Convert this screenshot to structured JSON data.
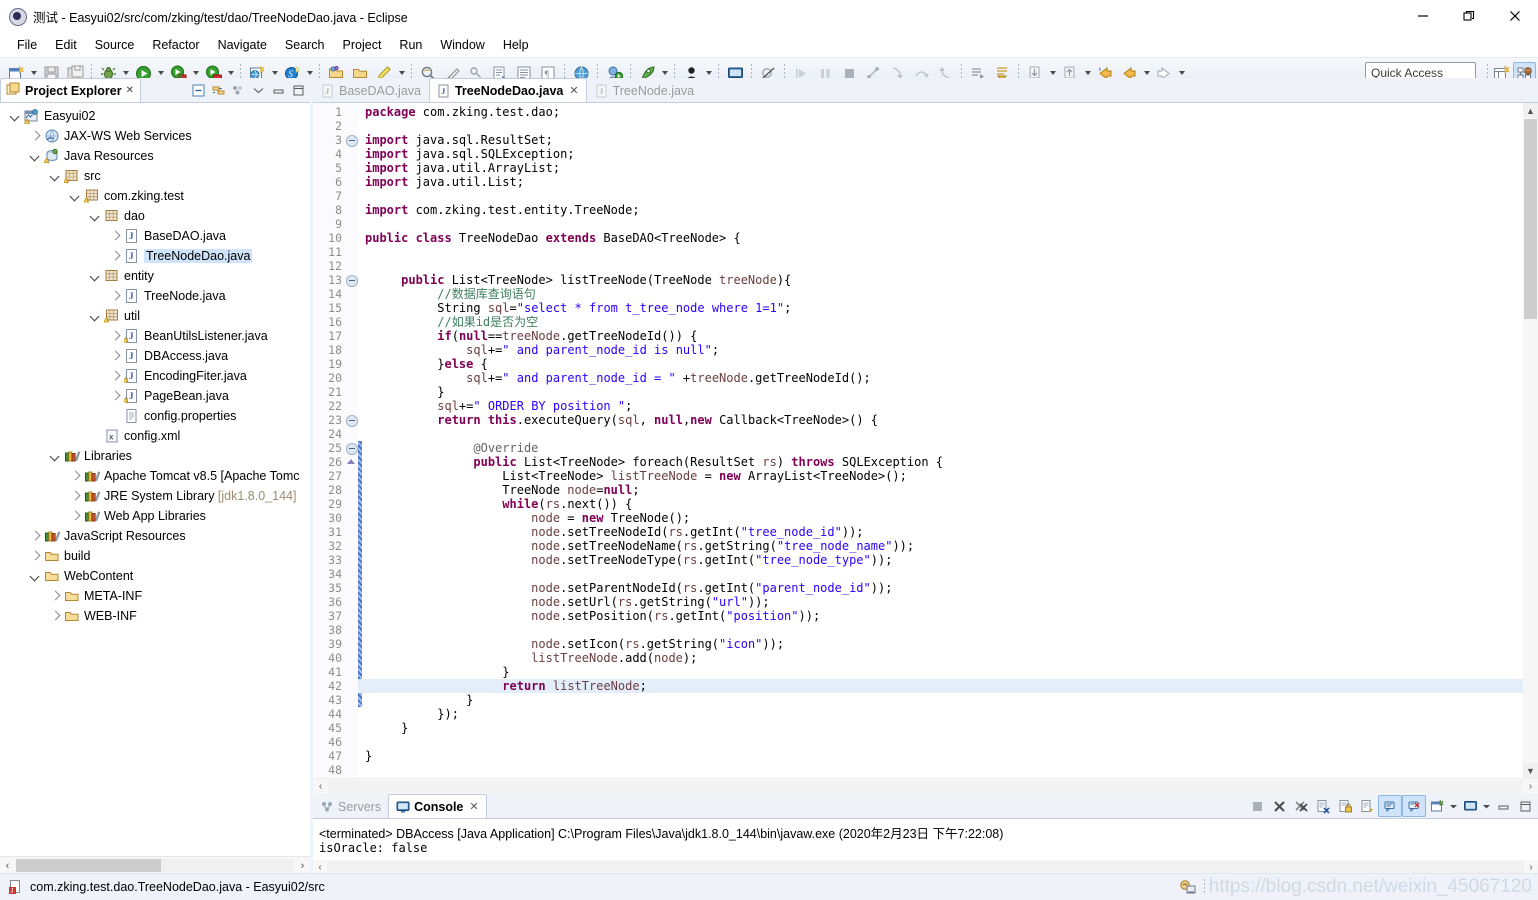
{
  "window": {
    "title": "测试 - Easyui02/src/com/zking/test/dao/TreeNodeDao.java - Eclipse",
    "app_icon": "eclipse-icon",
    "minimize": "–",
    "maximize": "❐",
    "close": "✕"
  },
  "menubar": {
    "items": [
      "File",
      "Edit",
      "Source",
      "Refactor",
      "Navigate",
      "Search",
      "Project",
      "Run",
      "Window",
      "Help"
    ]
  },
  "toolbar": {
    "quick_access_placeholder": "Quick Access",
    "groups": [
      {
        "buttons": [
          {
            "name": "new-icon",
            "glyph": "new",
            "arrow": true
          },
          {
            "name": "save-icon",
            "glyph": "save",
            "arrow": false
          },
          {
            "name": "save-all-icon",
            "glyph": "saveall",
            "arrow": false
          }
        ]
      },
      {
        "buttons": [
          {
            "name": "debug-icon",
            "glyph": "bug",
            "arrow": true
          },
          {
            "name": "run-icon",
            "glyph": "run",
            "arrow": true
          },
          {
            "name": "run-server-icon",
            "glyph": "runserver",
            "arrow": true
          },
          {
            "name": "stop-server-icon",
            "glyph": "stopserver",
            "arrow": true
          }
        ]
      },
      {
        "buttons": [
          {
            "name": "new-web-project-icon",
            "glyph": "webnew",
            "arrow": true
          },
          {
            "name": "new-sql-icon",
            "glyph": "sqlnew",
            "arrow": true
          }
        ]
      },
      {
        "buttons": [
          {
            "name": "open-type-icon",
            "glyph": "openfolder",
            "arrow": false
          },
          {
            "name": "open-resource-icon",
            "glyph": "folder",
            "arrow": false
          },
          {
            "name": "pencil-icon",
            "glyph": "pencil",
            "arrow": true
          }
        ]
      },
      {
        "buttons": [
          {
            "name": "search-icon",
            "glyph": "searchp",
            "arrow": false
          },
          {
            "name": "brush-icon",
            "glyph": "brush",
            "arrow": false
          },
          {
            "name": "link-icon",
            "glyph": "link",
            "arrow": false
          },
          {
            "name": "export-icon",
            "glyph": "export",
            "arrow": false
          },
          {
            "name": "list-icon",
            "glyph": "list",
            "arrow": false
          },
          {
            "name": "paragraph-icon",
            "glyph": "para",
            "arrow": false
          }
        ]
      },
      {
        "buttons": [
          {
            "name": "browser-icon",
            "glyph": "globe",
            "arrow": false
          }
        ]
      },
      {
        "buttons": [
          {
            "name": "run-as-icon",
            "glyph": "runas",
            "arrow": false
          }
        ]
      },
      {
        "buttons": [
          {
            "name": "new-server-icon",
            "glyph": "rocket",
            "arrow": true
          }
        ]
      },
      {
        "buttons": [
          {
            "name": "user-icon",
            "glyph": "person",
            "arrow": true
          }
        ]
      },
      {
        "buttons": [
          {
            "name": "terminal-icon",
            "glyph": "monitor",
            "arrow": false
          }
        ]
      },
      {
        "buttons": [
          {
            "name": "no-breakpoint-icon",
            "glyph": "nobp",
            "arrow": false
          }
        ]
      },
      {
        "buttons": [
          {
            "name": "step-resume-icon",
            "glyph": "resume",
            "arrow": false
          },
          {
            "name": "suspend-icon",
            "glyph": "suspend",
            "arrow": false
          },
          {
            "name": "terminate-icon",
            "glyph": "terminate",
            "arrow": false
          },
          {
            "name": "disconnect-icon",
            "glyph": "disconnect",
            "arrow": false
          },
          {
            "name": "step-into-icon",
            "glyph": "stepinto",
            "arrow": false
          },
          {
            "name": "step-over-icon",
            "glyph": "stepover",
            "arrow": false
          },
          {
            "name": "step-return-icon",
            "glyph": "stepreturn",
            "arrow": false
          }
        ]
      },
      {
        "buttons": [
          {
            "name": "next-annotation-icon",
            "glyph": "nextann",
            "arrow": false
          },
          {
            "name": "prev-annotation-icon",
            "glyph": "prevann",
            "arrow": false
          }
        ]
      },
      {
        "buttons": [
          {
            "name": "next-edit-icon",
            "glyph": "downedit",
            "arrow": true
          },
          {
            "name": "prev-edit-icon",
            "glyph": "upedit",
            "arrow": true
          },
          {
            "name": "back-star-icon",
            "glyph": "backstar",
            "arrow": false
          },
          {
            "name": "back-icon",
            "glyph": "back",
            "arrow": true
          },
          {
            "name": "forward-icon",
            "glyph": "forward",
            "arrow": true
          }
        ]
      }
    ],
    "perspective_new": "open-perspective-icon",
    "perspective_current": "java-ee-perspective-icon"
  },
  "explorer": {
    "tab_label": "Project Explorer",
    "tab_icon": "project-explorer-icon",
    "tab_close": "✕",
    "tools": [
      "collapse-all-icon",
      "link-with-editor-icon",
      "view-menu-icon",
      "minimize-icon",
      "maximize-icon"
    ],
    "tree": [
      {
        "depth": 0,
        "twisty": "down",
        "icon": "project-icon",
        "label": "Easyui02",
        "dim": "",
        "selected": false
      },
      {
        "depth": 1,
        "twisty": "right",
        "icon": "jaxws-icon",
        "label": "JAX-WS Web Services",
        "dim": "",
        "selected": false
      },
      {
        "depth": 1,
        "twisty": "down",
        "icon": "javares-icon",
        "label": "Java Resources",
        "dim": "",
        "selected": false
      },
      {
        "depth": 2,
        "twisty": "down",
        "icon": "srcfolder-icon",
        "label": "src",
        "dim": "",
        "selected": false
      },
      {
        "depth": 3,
        "twisty": "down",
        "icon": "package-warn-icon",
        "label": "com.zking.test",
        "dim": "",
        "selected": false
      },
      {
        "depth": 4,
        "twisty": "down",
        "icon": "package-icon",
        "label": "dao",
        "dim": "",
        "selected": false
      },
      {
        "depth": 5,
        "twisty": "right",
        "icon": "java-icon",
        "label": "BaseDAO.java",
        "dim": "",
        "selected": false
      },
      {
        "depth": 5,
        "twisty": "right",
        "icon": "java-icon",
        "label": "TreeNodeDao.java",
        "dim": "",
        "selected": true
      },
      {
        "depth": 4,
        "twisty": "down",
        "icon": "package-icon",
        "label": "entity",
        "dim": "",
        "selected": false
      },
      {
        "depth": 5,
        "twisty": "right",
        "icon": "java-icon",
        "label": "TreeNode.java",
        "dim": "",
        "selected": false
      },
      {
        "depth": 4,
        "twisty": "down",
        "icon": "package-warn-icon",
        "label": "util",
        "dim": "",
        "selected": false
      },
      {
        "depth": 5,
        "twisty": "right",
        "icon": "java-warn-icon",
        "label": "BeanUtilsListener.java",
        "dim": "",
        "selected": false
      },
      {
        "depth": 5,
        "twisty": "right",
        "icon": "java-icon",
        "label": "DBAccess.java",
        "dim": "",
        "selected": false
      },
      {
        "depth": 5,
        "twisty": "right",
        "icon": "java-warn-icon",
        "label": "EncodingFiter.java",
        "dim": "",
        "selected": false
      },
      {
        "depth": 5,
        "twisty": "right",
        "icon": "java-warn-icon",
        "label": "PageBean.java",
        "dim": "",
        "selected": false
      },
      {
        "depth": 5,
        "twisty": "none",
        "icon": "properties-icon",
        "label": "config.properties",
        "dim": "",
        "selected": false
      },
      {
        "depth": 4,
        "twisty": "none",
        "icon": "xml-icon",
        "label": "config.xml",
        "dim": "",
        "selected": false
      },
      {
        "depth": 2,
        "twisty": "down",
        "icon": "library-icon",
        "label": "Libraries",
        "dim": "",
        "selected": false
      },
      {
        "depth": 3,
        "twisty": "right",
        "icon": "library-icon",
        "label": "Apache Tomcat v8.5 [Apache Tomc",
        "dim": "",
        "selected": false
      },
      {
        "depth": 3,
        "twisty": "right",
        "icon": "library-icon",
        "label": "JRE System Library ",
        "dim": "[jdk1.8.0_144]",
        "selected": false
      },
      {
        "depth": 3,
        "twisty": "right",
        "icon": "library-icon",
        "label": "Web App Libraries",
        "dim": "",
        "selected": false
      },
      {
        "depth": 1,
        "twisty": "right",
        "icon": "library-icon",
        "label": "JavaScript Resources",
        "dim": "",
        "selected": false
      },
      {
        "depth": 1,
        "twisty": "right",
        "icon": "folder-icon",
        "label": "build",
        "dim": "",
        "selected": false
      },
      {
        "depth": 1,
        "twisty": "down",
        "icon": "folder-icon",
        "label": "WebContent",
        "dim": "",
        "selected": false
      },
      {
        "depth": 2,
        "twisty": "right",
        "icon": "folder-icon",
        "label": "META-INF",
        "dim": "",
        "selected": false
      },
      {
        "depth": 2,
        "twisty": "right",
        "icon": "folder-icon",
        "label": "WEB-INF",
        "dim": "",
        "selected": false
      }
    ],
    "hscroll_left": "‹",
    "hscroll_right": "›"
  },
  "editor": {
    "tabs": [
      {
        "label": "BaseDAO.java",
        "icon": "java-icon",
        "active": false,
        "closeable": false
      },
      {
        "label": "TreeNodeDao.java",
        "icon": "java-icon",
        "active": true,
        "closeable": true,
        "close": "✕"
      },
      {
        "label": "TreeNode.java",
        "icon": "java-icon",
        "active": false,
        "closeable": false
      }
    ],
    "first_line": 1,
    "last_line": 48,
    "highlight_line": 42,
    "fold_minus_lines": [
      3,
      13,
      23,
      25
    ],
    "fold_arrow_lines": [
      26
    ],
    "lines": [
      {
        "n": 1,
        "html": "<span class=\"kw\">package</span> com.zking.test.dao;"
      },
      {
        "n": 2,
        "html": ""
      },
      {
        "n": 3,
        "html": "<span class=\"kw\">import</span> java.sql.ResultSet;"
      },
      {
        "n": 4,
        "html": "<span class=\"kw\">import</span> java.sql.SQLException;"
      },
      {
        "n": 5,
        "html": "<span class=\"kw\">import</span> java.util.ArrayList;"
      },
      {
        "n": 6,
        "html": "<span class=\"kw\">import</span> java.util.List;"
      },
      {
        "n": 7,
        "html": ""
      },
      {
        "n": 8,
        "html": "<span class=\"kw\">import</span> com.zking.test.entity.TreeNode;"
      },
      {
        "n": 9,
        "html": ""
      },
      {
        "n": 10,
        "html": "<span class=\"kw\">public class</span> TreeNodeDao <span class=\"kw\">extends</span> BaseDAO&lt;TreeNode&gt; {"
      },
      {
        "n": 11,
        "html": ""
      },
      {
        "n": 12,
        "html": ""
      },
      {
        "n": 13,
        "html": "     <span class=\"kw\">public</span> List&lt;TreeNode&gt; listTreeNode(TreeNode <span class=\"loc\">treeNode</span>){"
      },
      {
        "n": 14,
        "html": "          <span class=\"cmt\">//数据库查询语句</span>"
      },
      {
        "n": 15,
        "html": "          String <span class=\"loc\">sql</span>=<span class=\"str\">\"select * from t_tree_node where 1=1\"</span>;"
      },
      {
        "n": 16,
        "html": "          <span class=\"cmt\">//如果id是否为空</span>"
      },
      {
        "n": 17,
        "html": "          <span class=\"kw\">if</span>(<span class=\"kw\">null</span>==<span class=\"loc\">treeNode</span>.getTreeNodeId()) {"
      },
      {
        "n": 18,
        "html": "              <span class=\"loc\">sql</span>+=<span class=\"str\">\" and parent_node_id is null\"</span>;"
      },
      {
        "n": 19,
        "html": "          }<span class=\"kw\">else</span> {"
      },
      {
        "n": 20,
        "html": "              <span class=\"loc\">sql</span>+=<span class=\"str\">\" and parent_node_id = \"</span> +<span class=\"loc\">treeNode</span>.getTreeNodeId();"
      },
      {
        "n": 21,
        "html": "          }"
      },
      {
        "n": 22,
        "html": "          <span class=\"loc\">sql</span>+=<span class=\"str\">\" ORDER BY position \"</span>;"
      },
      {
        "n": 23,
        "html": "          <span class=\"kw\">return this</span>.executeQuery(<span class=\"loc\">sql</span>, <span class=\"kw\">null</span>,<span class=\"kw\">new</span> Callback&lt;TreeNode&gt;() {"
      },
      {
        "n": 24,
        "html": ""
      },
      {
        "n": 25,
        "html": "               <span class=\"ann\">@Override</span>"
      },
      {
        "n": 26,
        "html": "               <span class=\"kw\">public</span> List&lt;TreeNode&gt; foreach(ResultSet <span class=\"loc\">rs</span>) <span class=\"kw\">throws</span> SQLException {"
      },
      {
        "n": 27,
        "html": "                   List&lt;TreeNode&gt; <span class=\"loc\">listTreeNode</span> = <span class=\"kw\">new</span> ArrayList&lt;TreeNode&gt;();"
      },
      {
        "n": 28,
        "html": "                   TreeNode <span class=\"loc\">node</span>=<span class=\"kw\">null</span>;"
      },
      {
        "n": 29,
        "html": "                   <span class=\"kw\">while</span>(<span class=\"loc\">rs</span>.next()) {"
      },
      {
        "n": 30,
        "html": "                       <span class=\"loc\">node</span> = <span class=\"kw\">new</span> TreeNode();"
      },
      {
        "n": 31,
        "html": "                       <span class=\"loc\">node</span>.setTreeNodeId(<span class=\"loc\">rs</span>.getInt(<span class=\"str\">\"tree_node_id\"</span>));"
      },
      {
        "n": 32,
        "html": "                       <span class=\"loc\">node</span>.setTreeNodeName(<span class=\"loc\">rs</span>.getString(<span class=\"str\">\"tree_node_name\"</span>));"
      },
      {
        "n": 33,
        "html": "                       <span class=\"loc\">node</span>.setTreeNodeType(<span class=\"loc\">rs</span>.getInt(<span class=\"str\">\"tree_node_type\"</span>));"
      },
      {
        "n": 34,
        "html": ""
      },
      {
        "n": 35,
        "html": "                       <span class=\"loc\">node</span>.setParentNodeId(<span class=\"loc\">rs</span>.getInt(<span class=\"str\">\"parent_node_id\"</span>));"
      },
      {
        "n": 36,
        "html": "                       <span class=\"loc\">node</span>.setUrl(<span class=\"loc\">rs</span>.getString(<span class=\"str\">\"url\"</span>));"
      },
      {
        "n": 37,
        "html": "                       <span class=\"loc\">node</span>.setPosition(<span class=\"loc\">rs</span>.getInt(<span class=\"str\">\"position\"</span>));"
      },
      {
        "n": 38,
        "html": ""
      },
      {
        "n": 39,
        "html": "                       <span class=\"loc\">node</span>.setIcon(<span class=\"loc\">rs</span>.getString(<span class=\"str\">\"icon\"</span>));"
      },
      {
        "n": 40,
        "html": "                       <span class=\"loc\">listTreeNode</span>.add(<span class=\"loc\">node</span>);"
      },
      {
        "n": 41,
        "html": "                   }"
      },
      {
        "n": 42,
        "html": "                   <span class=\"kw\">return</span> <span class=\"loc\">listTreeNode</span>;"
      },
      {
        "n": 43,
        "html": "              }"
      },
      {
        "n": 44,
        "html": "          });"
      },
      {
        "n": 45,
        "html": "     }"
      },
      {
        "n": 46,
        "html": ""
      },
      {
        "n": 47,
        "html": "}"
      },
      {
        "n": 48,
        "html": ""
      }
    ]
  },
  "console": {
    "tabs": [
      {
        "label": "Servers",
        "icon": "servers-icon",
        "active": false
      },
      {
        "label": "Console",
        "icon": "console-icon",
        "active": true,
        "close": "✕"
      }
    ],
    "terminated_line": "<terminated> DBAccess [Java Application] C:\\Program Files\\Java\\jdk1.8.0_144\\bin\\javaw.exe (2020年2月23日 下午7:22:08)",
    "output_line": "isOracle: false",
    "tools": [
      {
        "name": "terminate-icon",
        "on": false
      },
      {
        "name": "remove-launch-icon",
        "on": false
      },
      {
        "name": "remove-all-launches-icon",
        "on": false
      },
      {
        "name": "clear-console-icon",
        "on": false
      },
      {
        "name": "scroll-lock-icon",
        "on": false
      },
      {
        "name": "pin-console-icon",
        "on": false
      },
      {
        "name": "display-selected-console-icon",
        "on": true
      },
      {
        "name": "open-console-icon",
        "on": true
      },
      {
        "name": "new-console-view-icon",
        "on": false
      },
      {
        "name": "view-menu-icon",
        "on": false
      },
      {
        "name": "minimize-icon",
        "on": false
      },
      {
        "name": "maximize-icon",
        "on": false
      }
    ],
    "hscroll_left": "‹",
    "hscroll_right": "›"
  },
  "statusbar": {
    "icon": "java-file-icon",
    "text": "com.zking.test.dao.TreeNodeDao.java - Easyui02/src",
    "right_icon": "smartinsert-icon",
    "watermark": "https://blog.csdn.net/weixin_45067120"
  },
  "colors": {
    "accent": "#cfe4fb",
    "tab_border": "#c3cdde",
    "keyword": "#7f0055",
    "string": "#2a00ff",
    "comment": "#3f7f5f",
    "line_highlight": "#e4eefb",
    "toolbar_bg": "#eff3f9"
  }
}
